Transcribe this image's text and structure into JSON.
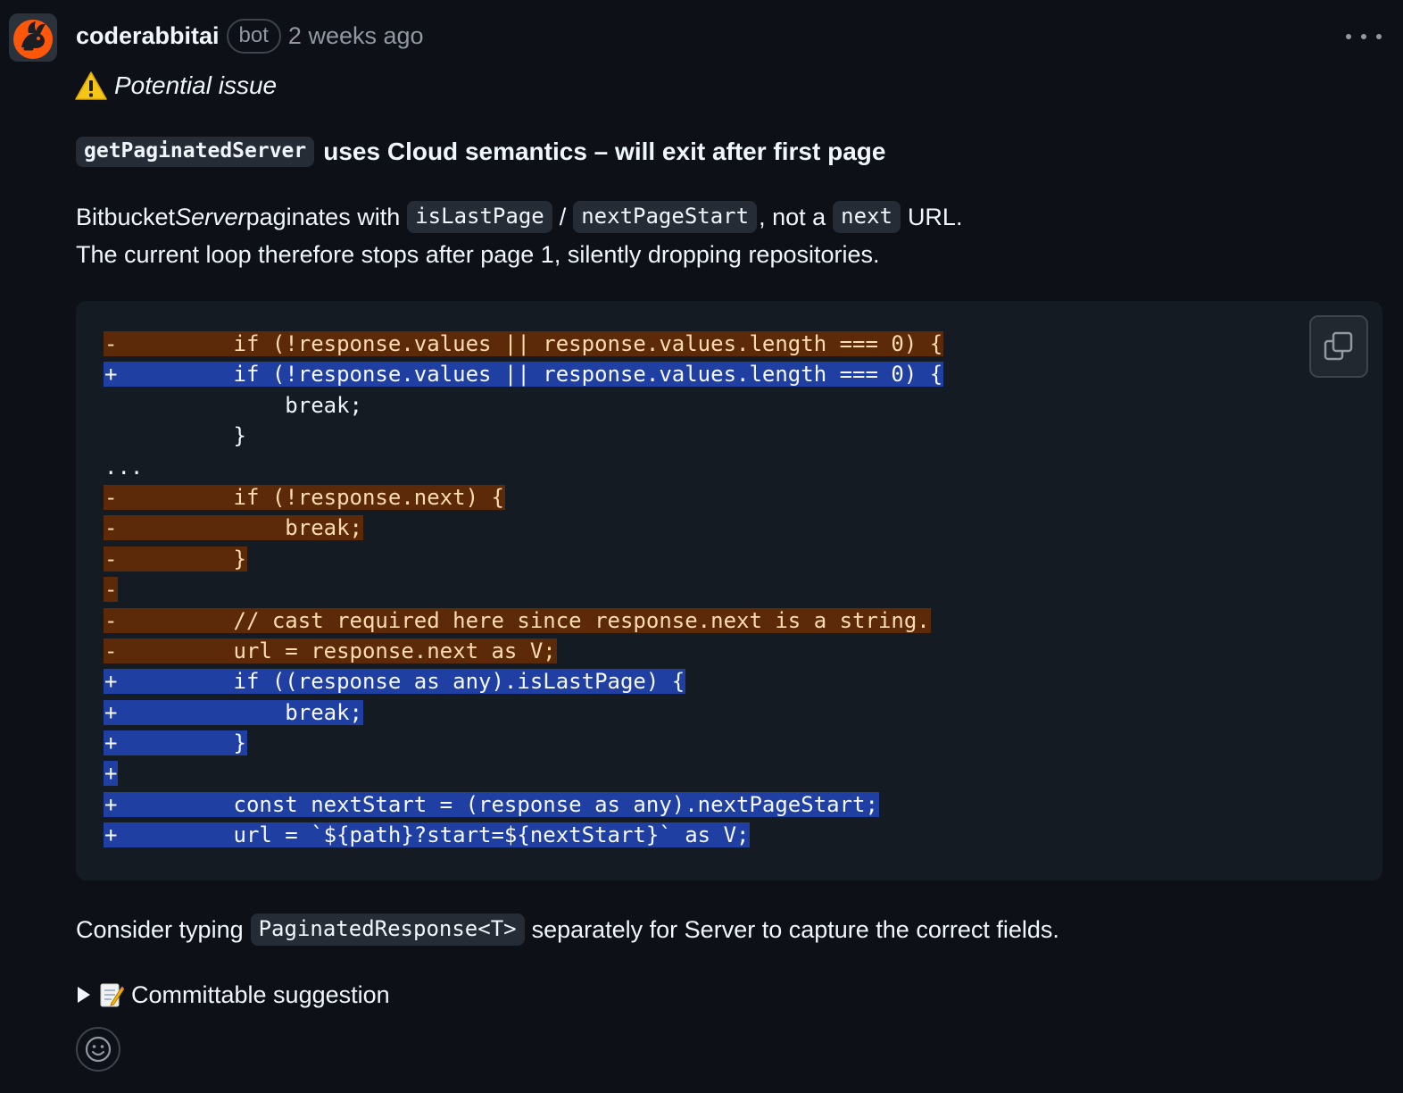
{
  "comment": {
    "author": "coderabbitai",
    "badge": "bot",
    "timestamp": "2 weeks ago",
    "issue_label": "Potential issue",
    "heading": {
      "code": "getPaginatedServer",
      "text": "uses Cloud semantics – will exit after first page"
    },
    "paragraph1": {
      "t1": "Bitbucket ",
      "t2": "Server",
      "t3": " paginates with",
      "c1": "isLastPage",
      "t4": "/",
      "c2": "nextPageStart",
      "t5": ", not a",
      "c3": "next",
      "t6": "URL."
    },
    "paragraph2": "The current loop therefore stops after page 1, silently dropping repositories.",
    "code_lines": [
      {
        "type": "del",
        "text": "-         if (!response.values || response.values.length === 0) {"
      },
      {
        "type": "add",
        "text": "+         if (!response.values || response.values.length === 0) {"
      },
      {
        "type": "ctx",
        "text": "              break;"
      },
      {
        "type": "ctx",
        "text": "          }"
      },
      {
        "type": "ctx",
        "text": "..."
      },
      {
        "type": "del",
        "text": "-         if (!response.next) {"
      },
      {
        "type": "del",
        "text": "-             break;"
      },
      {
        "type": "del",
        "text": "-         }"
      },
      {
        "type": "del",
        "text": "-"
      },
      {
        "type": "del",
        "text": "-         // cast required here since response.next is a string."
      },
      {
        "type": "del",
        "text": "-         url = response.next as V;"
      },
      {
        "type": "add",
        "text": "+         if ((response as any).isLastPage) {"
      },
      {
        "type": "add",
        "text": "+             break;"
      },
      {
        "type": "add",
        "text": "+         }"
      },
      {
        "type": "add",
        "text": "+"
      },
      {
        "type": "add",
        "text": "+         const nextStart = (response as any).nextPageStart;"
      },
      {
        "type": "add",
        "text": "+         url = `${path}?start=${nextStart}` as V;"
      }
    ],
    "paragraph3": {
      "t1": "Consider typing",
      "c1": "PaginatedResponse<T>",
      "t2": "separately for Server to capture the correct fields."
    },
    "details_label": "Committable suggestion",
    "icons": {
      "avatar": "coderabbit-logo-icon",
      "menu": "kebab-menu-icon",
      "warning": "warning-icon",
      "copy": "copy-icon",
      "expand": "triangle-right-icon",
      "memo": "memo-icon",
      "reaction": "smiley-icon"
    },
    "colors": {
      "background": "#0d1117",
      "code_background": "#151b23",
      "deleted_line": "#5c2a09",
      "added_line": "#1f3fa2",
      "muted_text": "#9198a1"
    }
  }
}
